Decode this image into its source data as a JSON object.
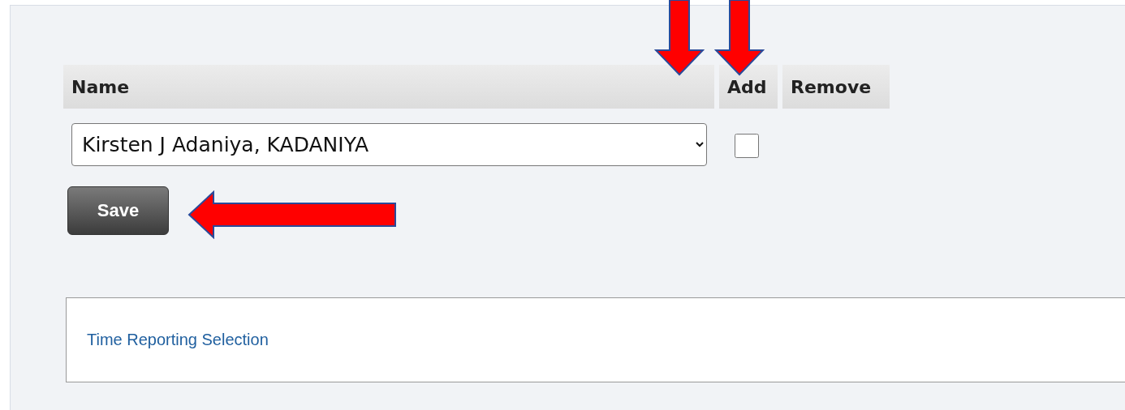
{
  "table": {
    "columns": [
      {
        "label": "Name"
      },
      {
        "label": "Add"
      },
      {
        "label": "Remove"
      }
    ],
    "rows": [
      {
        "name": "Kirsten J Adaniya, KADANIYA",
        "add_checked": false
      }
    ]
  },
  "save_button": {
    "label": "Save"
  },
  "section": {
    "link": "Time Reporting Selection"
  }
}
